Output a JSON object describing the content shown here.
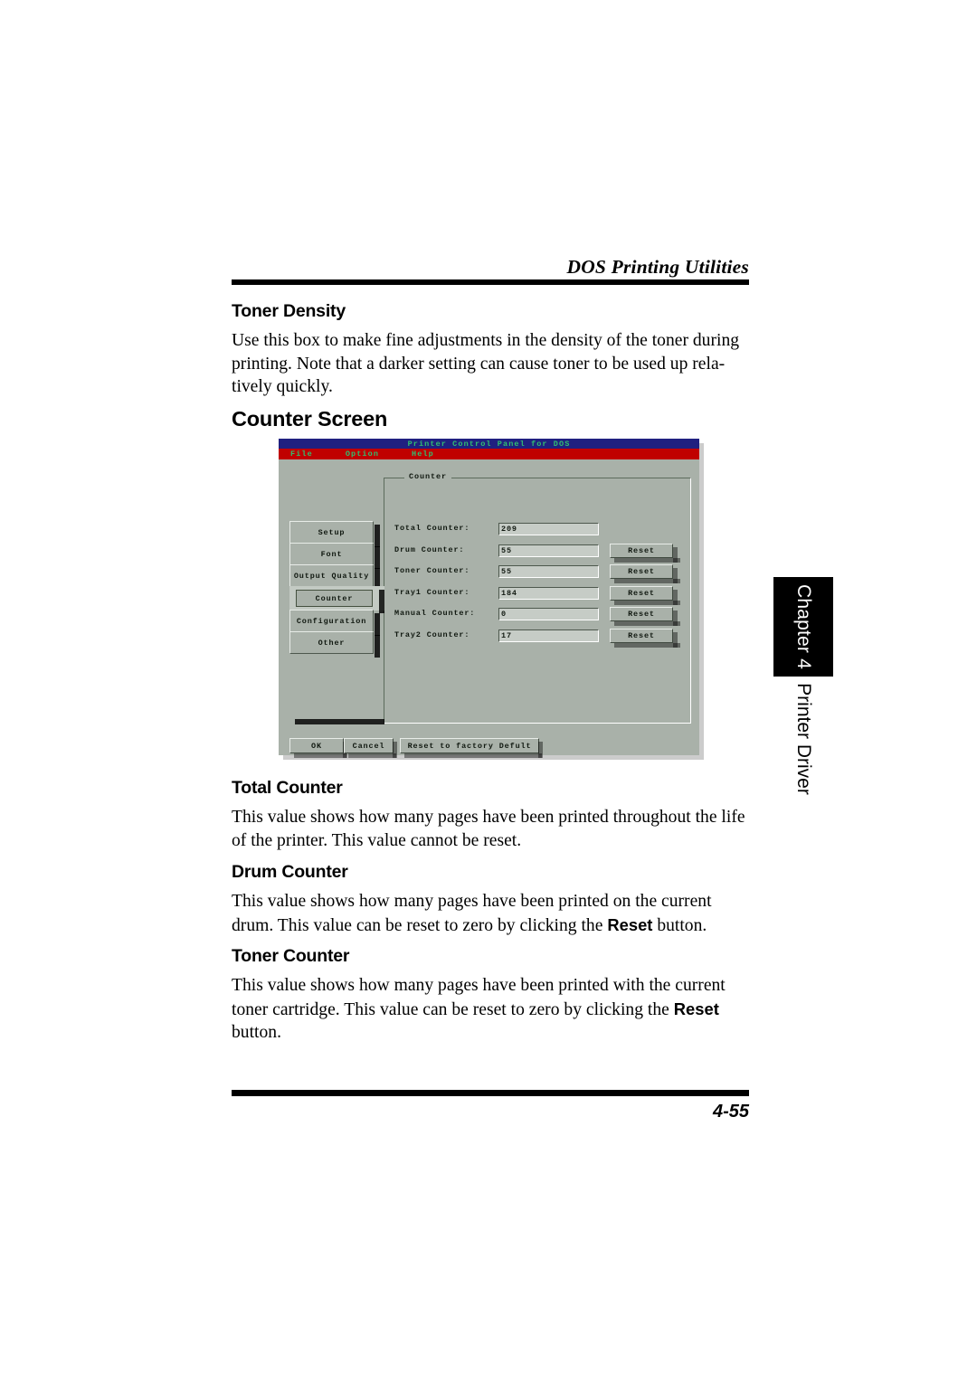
{
  "page": {
    "running_header": "DOS Printing Utilities",
    "page_number": "4-55"
  },
  "chapter_tab": {
    "chapter": "Chapter 4",
    "section": "Printer Driver"
  },
  "sections": [
    {
      "heading": "Toner Density",
      "body": "Use this box to make fine adjustments in the density of the toner during printing. Note that a darker setting can cause toner to be used up rela-tively quickly."
    },
    {
      "heading": "Counter Screen"
    },
    {
      "heading": "Total Counter",
      "body": "This value shows how many pages have been printed throughout the life of the printer. This value cannot be reset."
    },
    {
      "heading": "Drum Counter",
      "body_pre": "This value shows how many pages have been printed on the current drum. This value can be reset to zero by clicking the ",
      "body_bold": "Reset",
      "body_post": " button."
    },
    {
      "heading": "Toner Counter",
      "body_pre": "This value shows how many pages have been printed with the current toner cartridge. This value can be reset to zero by clicking the ",
      "body_bold": "Reset",
      "body_post": " button."
    }
  ],
  "dialog": {
    "title": "Printer Control Panel for DOS",
    "title_bg": "#202080",
    "title_fg": "#30c070",
    "menubar_bg": "#c00000",
    "menubar_fg": "#30c070",
    "face_color": "#a9b1a9",
    "menu": [
      {
        "label": "File"
      },
      {
        "label": "Option"
      },
      {
        "label": "Help"
      }
    ],
    "groupbox": {
      "label": "Counter"
    },
    "sidebar": [
      {
        "label": "Setup",
        "selected": false
      },
      {
        "label": "Font",
        "selected": false
      },
      {
        "label": "Output Quality",
        "selected": false
      },
      {
        "label": "Counter",
        "selected": true
      },
      {
        "label": "Configuration",
        "selected": false
      },
      {
        "label": "Other",
        "selected": false
      }
    ],
    "counters": [
      {
        "label": "Total Counter:",
        "value": "209",
        "reset": null
      },
      {
        "label": "Drum Counter:",
        "value": "55",
        "reset": "Reset"
      },
      {
        "label": "Toner Counter:",
        "value": "55",
        "reset": "Reset"
      },
      {
        "label": "Tray1 Counter:",
        "value": "184",
        "reset": "Reset"
      },
      {
        "label": "Manual Counter:",
        "value": "0",
        "reset": "Reset"
      },
      {
        "label": "Tray2 Counter:",
        "value": "17",
        "reset": "Reset"
      }
    ],
    "actions": [
      {
        "label": "OK"
      },
      {
        "label": "Cancel"
      },
      {
        "label": "Reset to factory Defult"
      }
    ]
  }
}
